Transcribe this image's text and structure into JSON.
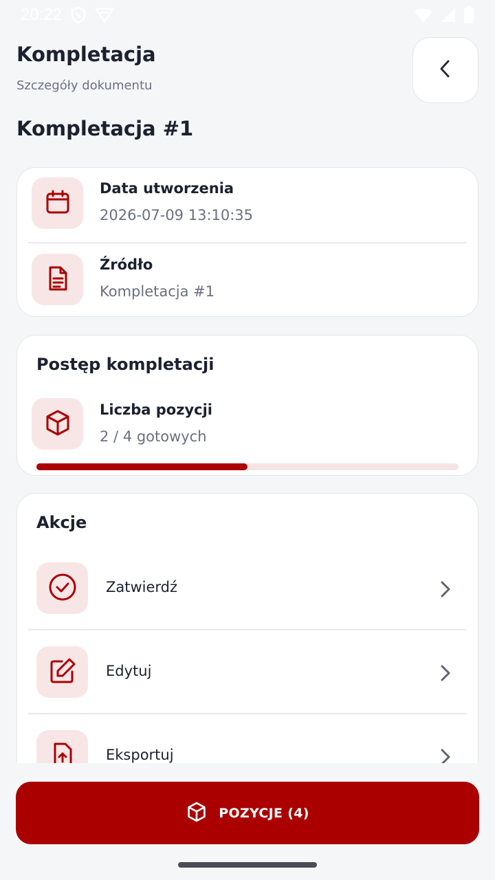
{
  "status_bar": {
    "time": "20:22",
    "icons": [
      "shield-icon",
      "vpn-icon",
      "wifi-icon",
      "signal-icon",
      "battery-icon"
    ]
  },
  "header": {
    "title": "Kompletacja",
    "subtitle": "Szczegóły dokumentu",
    "back_icon": "chevron-left-icon"
  },
  "document": {
    "title": "Kompletacja #1"
  },
  "info": {
    "created_label": "Data utworzenia",
    "created_value": "2026-07-09 13:10:35",
    "source_label": "Źródło",
    "source_value": "Kompletacja #1"
  },
  "progress": {
    "title": "Postęp kompletacji",
    "items_label": "Liczba pozycji",
    "items_value": "2 / 4 gotowych",
    "done": 2,
    "total": 4
  },
  "actions": {
    "title": "Akcje",
    "items": [
      {
        "label": "Zatwierdź",
        "icon": "check-circle-icon"
      },
      {
        "label": "Edytuj",
        "icon": "edit-icon"
      },
      {
        "label": "Eksportuj",
        "icon": "export-file-icon"
      }
    ]
  },
  "footer": {
    "positions_button": "POZYCJE (4)"
  },
  "colors": {
    "accent": "#aa0000",
    "icon_bg": "#f8e6e7",
    "background": "#f5f6f8"
  }
}
